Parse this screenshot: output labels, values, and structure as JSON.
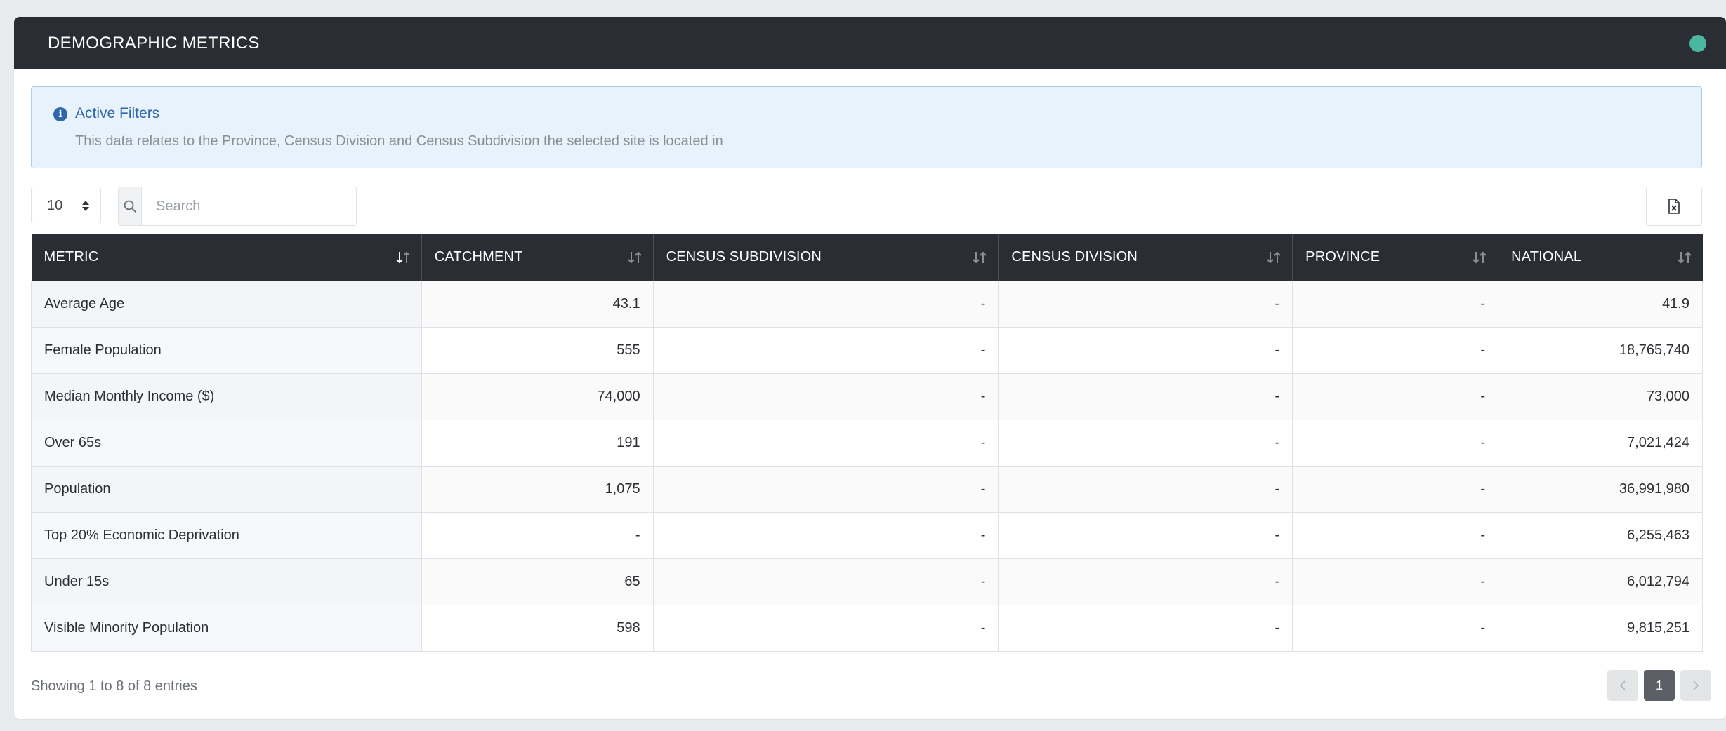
{
  "header": {
    "title": "DEMOGRAPHIC METRICS",
    "status_color": "#4db6a0"
  },
  "alert": {
    "icon": "info-icon",
    "title": "Active Filters",
    "text": "This data relates to the Province, Census Division and Census Subdivision the selected site is located in"
  },
  "controls": {
    "page_length": "10",
    "search_placeholder": "Search",
    "search_value": "",
    "export_icon": "excel-file-icon"
  },
  "table": {
    "columns": [
      {
        "label": "METRIC",
        "sort": "ascending"
      },
      {
        "label": "CATCHMENT",
        "sort": "none"
      },
      {
        "label": "CENSUS SUBDIVISION",
        "sort": "none"
      },
      {
        "label": "CENSUS DIVISION",
        "sort": "none"
      },
      {
        "label": "PROVINCE",
        "sort": "none"
      },
      {
        "label": "NATIONAL",
        "sort": "none"
      }
    ],
    "rows": [
      [
        "Average Age",
        "43.1",
        "-",
        "-",
        "-",
        "41.9"
      ],
      [
        "Female Population",
        "555",
        "-",
        "-",
        "-",
        "18,765,740"
      ],
      [
        "Median Monthly Income ($)",
        "74,000",
        "-",
        "-",
        "-",
        "73,000"
      ],
      [
        "Over 65s",
        "191",
        "-",
        "-",
        "-",
        "7,021,424"
      ],
      [
        "Population",
        "1,075",
        "-",
        "-",
        "-",
        "36,991,980"
      ],
      [
        "Top 20% Economic Deprivation",
        "-",
        "-",
        "-",
        "-",
        "6,255,463"
      ],
      [
        "Under 15s",
        "65",
        "-",
        "-",
        "-",
        "6,012,794"
      ],
      [
        "Visible Minority Population",
        "598",
        "-",
        "-",
        "-",
        "9,815,251"
      ]
    ]
  },
  "footer": {
    "info": "Showing 1 to 8 of 8 entries",
    "current_page": "1"
  }
}
